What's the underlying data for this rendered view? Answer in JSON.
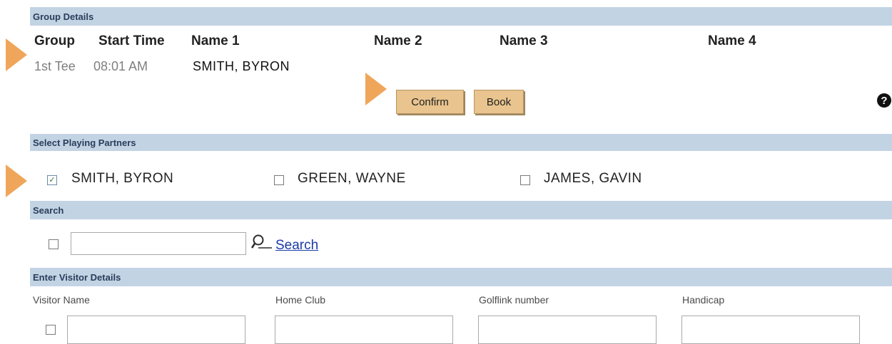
{
  "sections": {
    "group_details": "Group Details",
    "select_partners": "Select Playing Partners",
    "search": "Search",
    "visitor_details": "Enter Visitor Details"
  },
  "group_table": {
    "headers": [
      "Group",
      "Start Time",
      "Name 1",
      "Name 2",
      "Name 3",
      "Name 4"
    ],
    "row": {
      "group": "1st Tee",
      "start_time": "08:01 AM",
      "name1": "SMITH, BYRON"
    }
  },
  "buttons": {
    "confirm": "Confirm",
    "book": "Book",
    "help": "?"
  },
  "partners": [
    {
      "name": "SMITH, BYRON",
      "checked": true
    },
    {
      "name": "GREEN, WAYNE",
      "checked": false
    },
    {
      "name": "JAMES, GAVIN",
      "checked": false
    }
  ],
  "search": {
    "input_value": "",
    "link_label": "Search"
  },
  "visitor": {
    "labels": [
      "Visitor Name",
      "Home Club",
      "Golflink number",
      "Handicap"
    ]
  },
  "colors": {
    "section_bar": "#c2d3e4",
    "button": "#e9c48e",
    "arrow": "#f0a65a",
    "link": "#1a3aa8"
  }
}
